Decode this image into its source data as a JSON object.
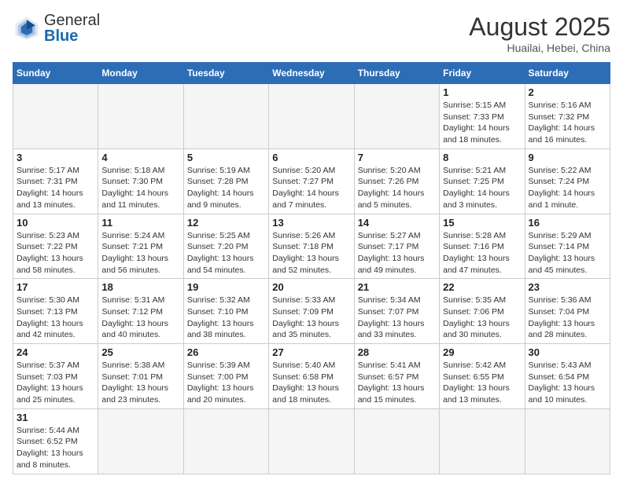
{
  "header": {
    "logo_general": "General",
    "logo_blue": "Blue",
    "month_year": "August 2025",
    "location": "Huailai, Hebei, China"
  },
  "weekdays": [
    "Sunday",
    "Monday",
    "Tuesday",
    "Wednesday",
    "Thursday",
    "Friday",
    "Saturday"
  ],
  "weeks": [
    [
      {
        "day": "",
        "info": ""
      },
      {
        "day": "",
        "info": ""
      },
      {
        "day": "",
        "info": ""
      },
      {
        "day": "",
        "info": ""
      },
      {
        "day": "",
        "info": ""
      },
      {
        "day": "1",
        "info": "Sunrise: 5:15 AM\nSunset: 7:33 PM\nDaylight: 14 hours and 18 minutes."
      },
      {
        "day": "2",
        "info": "Sunrise: 5:16 AM\nSunset: 7:32 PM\nDaylight: 14 hours and 16 minutes."
      }
    ],
    [
      {
        "day": "3",
        "info": "Sunrise: 5:17 AM\nSunset: 7:31 PM\nDaylight: 14 hours and 13 minutes."
      },
      {
        "day": "4",
        "info": "Sunrise: 5:18 AM\nSunset: 7:30 PM\nDaylight: 14 hours and 11 minutes."
      },
      {
        "day": "5",
        "info": "Sunrise: 5:19 AM\nSunset: 7:28 PM\nDaylight: 14 hours and 9 minutes."
      },
      {
        "day": "6",
        "info": "Sunrise: 5:20 AM\nSunset: 7:27 PM\nDaylight: 14 hours and 7 minutes."
      },
      {
        "day": "7",
        "info": "Sunrise: 5:20 AM\nSunset: 7:26 PM\nDaylight: 14 hours and 5 minutes."
      },
      {
        "day": "8",
        "info": "Sunrise: 5:21 AM\nSunset: 7:25 PM\nDaylight: 14 hours and 3 minutes."
      },
      {
        "day": "9",
        "info": "Sunrise: 5:22 AM\nSunset: 7:24 PM\nDaylight: 14 hours and 1 minute."
      }
    ],
    [
      {
        "day": "10",
        "info": "Sunrise: 5:23 AM\nSunset: 7:22 PM\nDaylight: 13 hours and 58 minutes."
      },
      {
        "day": "11",
        "info": "Sunrise: 5:24 AM\nSunset: 7:21 PM\nDaylight: 13 hours and 56 minutes."
      },
      {
        "day": "12",
        "info": "Sunrise: 5:25 AM\nSunset: 7:20 PM\nDaylight: 13 hours and 54 minutes."
      },
      {
        "day": "13",
        "info": "Sunrise: 5:26 AM\nSunset: 7:18 PM\nDaylight: 13 hours and 52 minutes."
      },
      {
        "day": "14",
        "info": "Sunrise: 5:27 AM\nSunset: 7:17 PM\nDaylight: 13 hours and 49 minutes."
      },
      {
        "day": "15",
        "info": "Sunrise: 5:28 AM\nSunset: 7:16 PM\nDaylight: 13 hours and 47 minutes."
      },
      {
        "day": "16",
        "info": "Sunrise: 5:29 AM\nSunset: 7:14 PM\nDaylight: 13 hours and 45 minutes."
      }
    ],
    [
      {
        "day": "17",
        "info": "Sunrise: 5:30 AM\nSunset: 7:13 PM\nDaylight: 13 hours and 42 minutes."
      },
      {
        "day": "18",
        "info": "Sunrise: 5:31 AM\nSunset: 7:12 PM\nDaylight: 13 hours and 40 minutes."
      },
      {
        "day": "19",
        "info": "Sunrise: 5:32 AM\nSunset: 7:10 PM\nDaylight: 13 hours and 38 minutes."
      },
      {
        "day": "20",
        "info": "Sunrise: 5:33 AM\nSunset: 7:09 PM\nDaylight: 13 hours and 35 minutes."
      },
      {
        "day": "21",
        "info": "Sunrise: 5:34 AM\nSunset: 7:07 PM\nDaylight: 13 hours and 33 minutes."
      },
      {
        "day": "22",
        "info": "Sunrise: 5:35 AM\nSunset: 7:06 PM\nDaylight: 13 hours and 30 minutes."
      },
      {
        "day": "23",
        "info": "Sunrise: 5:36 AM\nSunset: 7:04 PM\nDaylight: 13 hours and 28 minutes."
      }
    ],
    [
      {
        "day": "24",
        "info": "Sunrise: 5:37 AM\nSunset: 7:03 PM\nDaylight: 13 hours and 25 minutes."
      },
      {
        "day": "25",
        "info": "Sunrise: 5:38 AM\nSunset: 7:01 PM\nDaylight: 13 hours and 23 minutes."
      },
      {
        "day": "26",
        "info": "Sunrise: 5:39 AM\nSunset: 7:00 PM\nDaylight: 13 hours and 20 minutes."
      },
      {
        "day": "27",
        "info": "Sunrise: 5:40 AM\nSunset: 6:58 PM\nDaylight: 13 hours and 18 minutes."
      },
      {
        "day": "28",
        "info": "Sunrise: 5:41 AM\nSunset: 6:57 PM\nDaylight: 13 hours and 15 minutes."
      },
      {
        "day": "29",
        "info": "Sunrise: 5:42 AM\nSunset: 6:55 PM\nDaylight: 13 hours and 13 minutes."
      },
      {
        "day": "30",
        "info": "Sunrise: 5:43 AM\nSunset: 6:54 PM\nDaylight: 13 hours and 10 minutes."
      }
    ],
    [
      {
        "day": "31",
        "info": "Sunrise: 5:44 AM\nSunset: 6:52 PM\nDaylight: 13 hours and 8 minutes."
      },
      {
        "day": "",
        "info": ""
      },
      {
        "day": "",
        "info": ""
      },
      {
        "day": "",
        "info": ""
      },
      {
        "day": "",
        "info": ""
      },
      {
        "day": "",
        "info": ""
      },
      {
        "day": "",
        "info": ""
      }
    ]
  ]
}
